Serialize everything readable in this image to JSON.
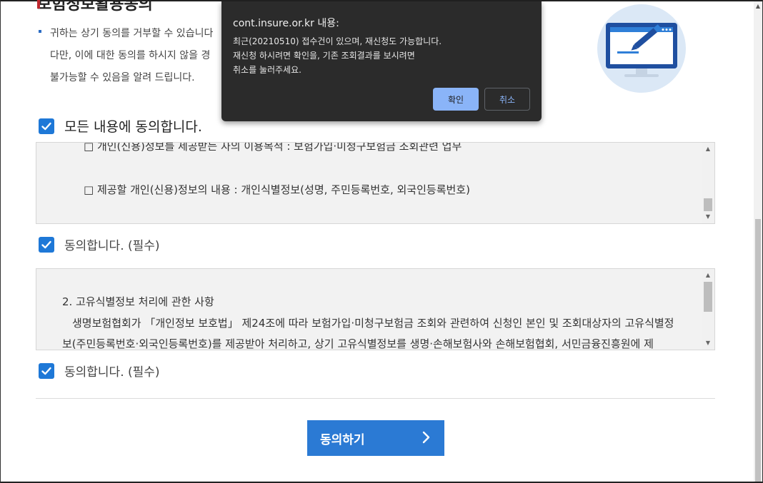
{
  "page": {
    "heading_partial": "보험정보활용동의",
    "notice_lines": [
      "귀하는 상기 동의를 거부할 수 있습니다",
      "다만, 이에 대한 동의를 하시지 않을 경",
      "불가능할 수 있음을 알려 드립니다."
    ]
  },
  "agree_all": {
    "label": "모든 내용에 동의합니다.",
    "checked": true
  },
  "box1": {
    "line_top": "□ 개인(신용)정보를 제공받는 자의 이용목적 : 보험가입·미청구보험금 조회관련 업무",
    "line_main": "□ 제공할 개인(신용)정보의 내용 : 개인식별정보(성명, 주민등록번호, 외국인등록번호)"
  },
  "agree1": {
    "label": "동의합니다. (필수)",
    "checked": true
  },
  "box2": {
    "heading": "2. 고유식별정보 처리에 관한 사항",
    "para_line1": "생명보험협회가 「개인정보 보호법」 제24조에 따라 보험가입·미청구보험금 조회와 관련하여 신청인 본인 및 조회대상자의 고유식별정",
    "para_line2": "보(주민등록번호·외국인등록번호)를 제공받아 처리하고, 상기 고유식별정보를 생명·손해보험사와 손해보험협회, 서민금융진흥원에 제"
  },
  "agree2": {
    "label": "동의합니다. (필수)",
    "checked": true
  },
  "submit": {
    "label": "동의하기"
  },
  "dialog": {
    "title": "cont.insure.or.kr 내용:",
    "message_lines": [
      "최근(20210510) 접수건이 있으며, 재신청도 가능합니다.",
      "재신청 하시려면 확인을, 기존 조회결과를 보시려면",
      "취소를 눌러주세요."
    ],
    "ok_label": "확인",
    "cancel_label": "취소"
  },
  "colors": {
    "accent": "#2b7ad4",
    "checkbox": "#1e78d7",
    "dialog_bg": "#2b2b2b",
    "dialog_ok": "#8ab4f8"
  },
  "icons": {
    "checkbox": "check-icon",
    "submit": "chevron-right-icon",
    "illustration": "monitor-pen-icon"
  }
}
